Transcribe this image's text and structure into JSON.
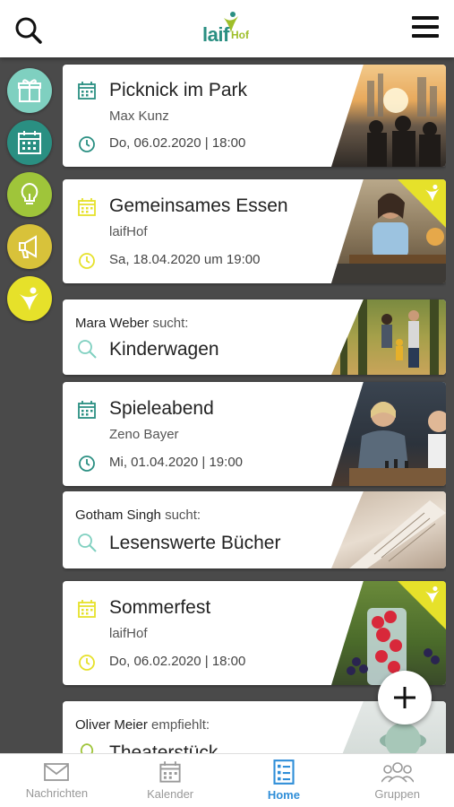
{
  "header": {
    "search_icon": "search-icon",
    "menu_icon": "hamburger-menu-icon",
    "logo_text": "laif",
    "logo_sub": "Hof"
  },
  "rail": [
    {
      "icon": "gift-icon",
      "color": "#7fd0c0"
    },
    {
      "icon": "calendar-icon",
      "color": "#2a8f82"
    },
    {
      "icon": "lightbulb-icon",
      "color": "#9fc53a"
    },
    {
      "icon": "megaphone-icon",
      "color": "#d8c23a"
    },
    {
      "icon": "person-logo-icon",
      "color": "#e6e12a"
    }
  ],
  "cards": [
    {
      "type": "event",
      "title": "Picknick im Park",
      "host": "Max Kunz",
      "date": "Do, 06.02.2020 | 18:00"
    },
    {
      "type": "event",
      "title": "Gemeinsames Essen",
      "host": "laifHof",
      "date": "Sa, 18.04.2020 um 19:00"
    },
    {
      "type": "search",
      "person": "Mara Weber",
      "verb": "sucht:",
      "title": "Kinderwagen"
    },
    {
      "type": "event",
      "title": "Spieleabend",
      "host": "Zeno Bayer",
      "date": "Mi, 01.04.2020 | 19:00"
    },
    {
      "type": "search",
      "person": "Gotham Singh",
      "verb": "sucht:",
      "title": "Lesenswerte Bücher"
    },
    {
      "type": "event",
      "title": "Sommerfest",
      "host": "laifHof",
      "date": "Do, 06.02.2020 | 18:00"
    },
    {
      "type": "recommend",
      "person": "Oliver Meier",
      "verb": "empfiehlt:",
      "title": "Theaterstück"
    }
  ],
  "fab": {
    "icon": "plus-icon"
  },
  "bottom_nav": [
    {
      "label": "Nachrichten",
      "icon": "envelope-icon"
    },
    {
      "label": "Kalender",
      "icon": "calendar-icon"
    },
    {
      "label": "Home",
      "icon": "list-icon",
      "active": true
    },
    {
      "label": "Gruppen",
      "icon": "group-icon"
    }
  ],
  "colors": {
    "teal": "#2a8f82",
    "yellow": "#e6e12a",
    "active": "#2f8ed8"
  }
}
